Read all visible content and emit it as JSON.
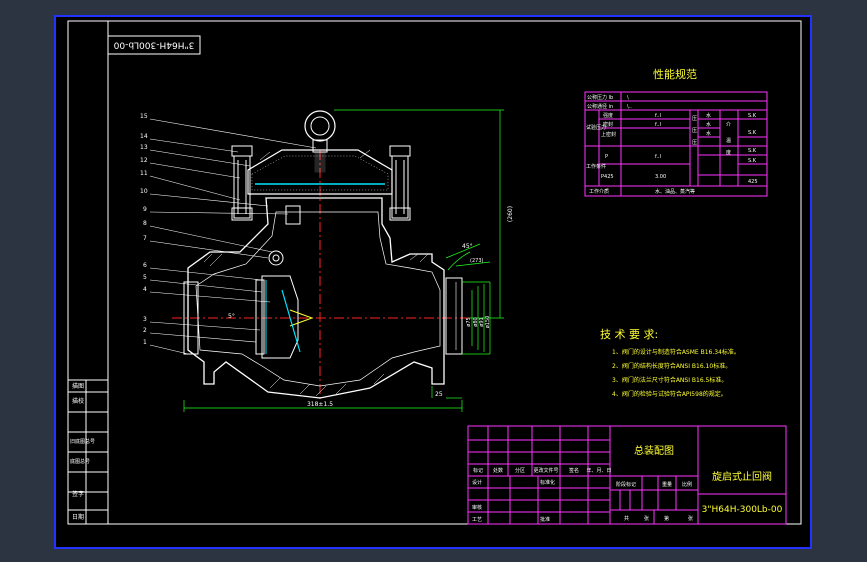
{
  "drawing_code_rotated": "3\"H64H-300Lb-00",
  "perf_title": "性能规范",
  "perf_table": {
    "r1_label": "公称压力 lb",
    "r1_val": "\\",
    "r2_label": "公称通径 in",
    "r2_val": "\\..",
    "r3_group": "试验压力",
    "r3_items": [
      "强度",
      "密封",
      "上密封"
    ],
    "r3_vals": [
      "f..l",
      "f..l",
      ""
    ],
    "r3_right": [
      "水",
      "水",
      "水"
    ],
    "r3_right2": [
      "压",
      "压",
      "压"
    ],
    "r4_group": "工作条件",
    "r4_items": [
      "P",
      "P425"
    ],
    "r4_vals": [
      "f..l",
      "3.00"
    ],
    "mid_col": [
      "介",
      "温",
      "度"
    ],
    "right_vals": [
      "S.K",
      "S.K",
      "S.K",
      "S.K",
      "425"
    ],
    "medium_label": "工作介质",
    "medium_val": "水、油品、蒸汽等"
  },
  "tech_title": "技 术 要 求:",
  "tech_items": [
    "1、阀门的设计与制造符合ASME B16.34标准。",
    "2、阀门的结构长度符合ANSI B16.10标准。",
    "3、阀门的法兰尺寸符合ANSI B16.5标准。",
    "4、阀门的检验与试验符合API598的规定。"
  ],
  "leader_numbers": [
    "15",
    "14",
    "13",
    "12",
    "11",
    "10",
    "9",
    "8",
    "7",
    "6",
    "5",
    "4",
    "3",
    "2",
    "1"
  ],
  "dimensions": {
    "overall_length": "318±1.5",
    "angle": "45°",
    "height": "(260)",
    "d1": "ø75",
    "d2": "ø80",
    "d3": "ø91",
    "d4": "ø150",
    "flange_thk": "25",
    "small_dim": "(273)",
    "angle2": "5°"
  },
  "title_block": {
    "assembly": "总装配图",
    "product_name": "旋启式止回阀",
    "drawing_no": "3\"H64H-300Lb-00",
    "header_cells": [
      "标记",
      "处数",
      "分区",
      "更改文件号",
      "签名",
      "年、月、日"
    ],
    "sign_labels": [
      "设计",
      "标准化",
      "审核",
      "工艺",
      "批准"
    ],
    "stage_labels": [
      "阶段标记",
      "重量",
      "比例"
    ],
    "bottom_labels": [
      "共",
      "张",
      "第",
      "张"
    ]
  },
  "left_strip": [
    "描图",
    "描校",
    "旧底图总号",
    "底图总号",
    "签字",
    "日期"
  ]
}
